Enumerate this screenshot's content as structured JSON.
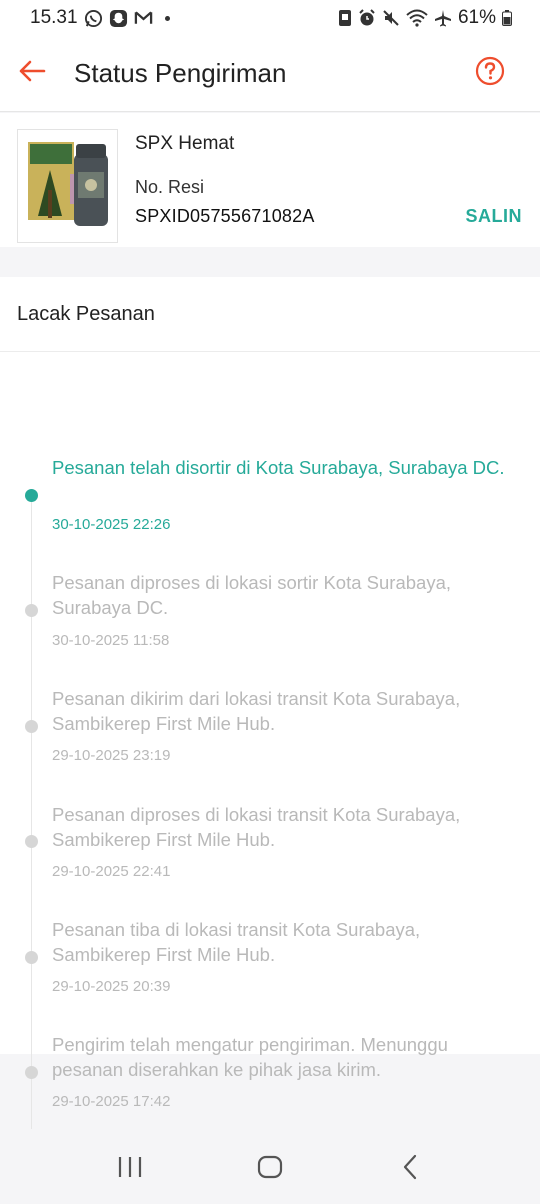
{
  "status_bar": {
    "time": "15.31",
    "battery": "61%"
  },
  "header": {
    "title": "Status Pengiriman"
  },
  "package": {
    "courier": "SPX Hemat",
    "resi_label": "No. Resi",
    "resi_number": "SPXID05755671082A",
    "copy_label": "SALIN"
  },
  "tracking": {
    "heading": "Lacak Pesanan",
    "events": [
      {
        "text": "Pesanan telah disortir di Kota Surabaya, Surabaya DC.",
        "time": "30-10-2025 22:26",
        "active": true
      },
      {
        "text": "Pesanan diproses di lokasi sortir Kota Surabaya, Surabaya DC.",
        "time": "30-10-2025 11:58",
        "active": false
      },
      {
        "text": "Pesanan dikirim dari lokasi transit Kota Surabaya, Sambikerep First Mile Hub.",
        "time": "29-10-2025 23:19",
        "active": false
      },
      {
        "text": "Pesanan diproses di lokasi transit Kota Surabaya, Sambikerep First Mile Hub.",
        "time": "29-10-2025 22:41",
        "active": false
      },
      {
        "text": "Pesanan tiba di lokasi transit Kota Surabaya, Sambikerep First Mile Hub.",
        "time": "29-10-2025 20:39",
        "active": false
      },
      {
        "text": "Pengirim telah mengatur pengiriman. Menunggu pesanan diserahkan ke pihak jasa kirim.",
        "time": "29-10-2025 17:42",
        "active": false
      }
    ]
  },
  "colors": {
    "accent": "#ee4d2d",
    "active_green": "#26aa99",
    "inactive_gray": "#b9b9b9"
  },
  "icons": {
    "back": "arrow-left-icon",
    "help": "question-circle-icon",
    "nav_recent": "recent-apps-icon",
    "nav_home": "home-icon",
    "nav_back": "chevron-left-icon"
  }
}
